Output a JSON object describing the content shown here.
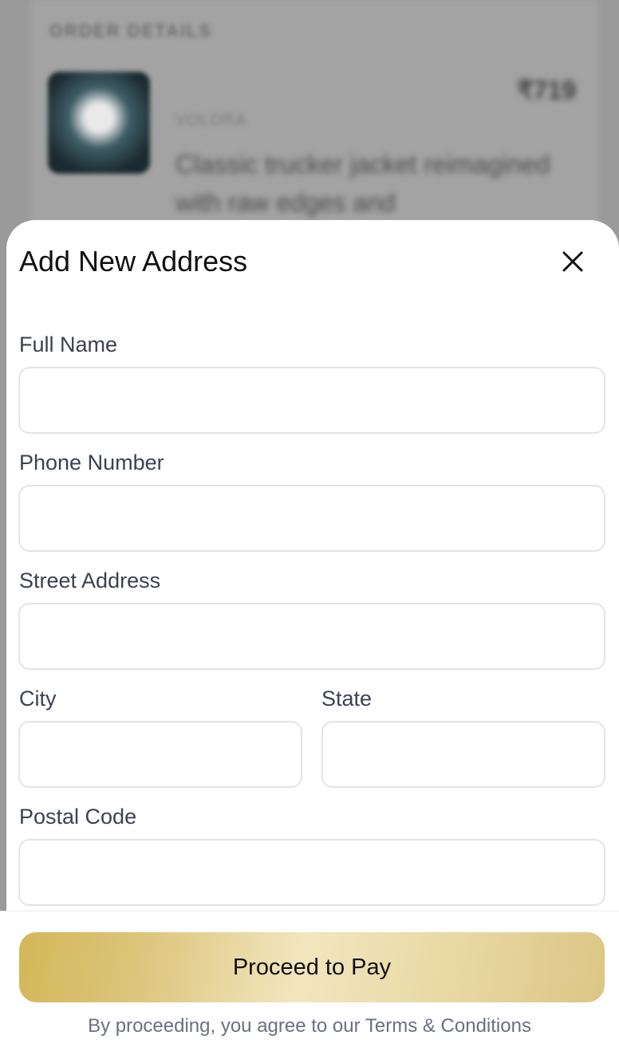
{
  "background": {
    "heading": "ORDER DETAILS",
    "price": "₹719",
    "brand": "VOLORA",
    "description": "Classic trucker jacket reimagined with raw edges and"
  },
  "modal": {
    "title": "Add New Address",
    "close_icon": "close-icon",
    "fields": {
      "full_name": {
        "label": "Full Name",
        "value": ""
      },
      "phone": {
        "label": "Phone Number",
        "value": ""
      },
      "street": {
        "label": "Street Address",
        "value": ""
      },
      "city": {
        "label": "City",
        "value": ""
      },
      "state": {
        "label": "State",
        "value": ""
      },
      "postal": {
        "label": "Postal Code",
        "value": ""
      }
    }
  },
  "footer": {
    "pay_label": "Proceed to Pay",
    "terms_prefix": "By proceeding, you agree to our ",
    "terms_link": "Terms & Conditions"
  },
  "colors": {
    "accent_gold": "#d3b758",
    "label_text": "#3b4150",
    "input_border": "#e3e4e8"
  }
}
